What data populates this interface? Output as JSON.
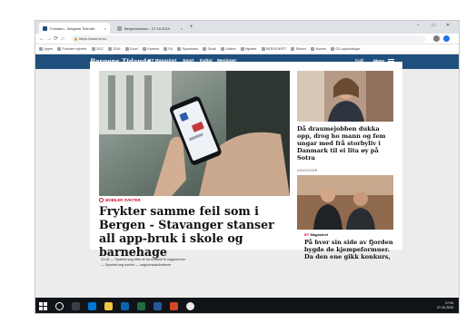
{
  "browser": {
    "tabs": [
      {
        "title": "Forsiden - Bergens Tidende",
        "active": true
      },
      {
        "title": "Bergensavisen - 27.10.2019",
        "active": false
      }
    ],
    "new_tab": "+",
    "window_controls": [
      "–",
      "▭",
      "✕"
    ],
    "nav": {
      "back": "←",
      "forward": "→",
      "reload": "⟳",
      "home": "⌂"
    },
    "url": "https://www.bt.no",
    "bookmarks": [
      "Apper",
      "Forsiden nyheter",
      "2017",
      "2016",
      "Excel",
      "Kamera",
      "EA",
      "Sparebank",
      "Gmail",
      "Vosbot",
      "Nyheter",
      "BERGENSET",
      "Skriver",
      "Norske",
      "OD-oppkoblinger"
    ]
  },
  "site": {
    "logo": "Bergens Tidende",
    "nav_items": [
      "BT Magasinet",
      "Sport",
      "Kultur",
      "Meninger"
    ],
    "login": "Kjøll",
    "menu_label": "Meny"
  },
  "article": {
    "kicker": "MOBILER SVIKTER",
    "headline": "Frykter samme feil som i Bergen - Stavanger stanser all app-bruk i skole og barnehage",
    "sublink": "31:16 — Sparket seg etter at ha snakket til ungdommer",
    "sublink2": "— Sparket seg sortert — ungdomsskoleelever"
  },
  "side_articles": [
    {
      "title": "Då draumejobben dukka opp, drog ho mann og fem ungar med frå storbyliv i Danmark til ei lita øy på Sotra",
      "label": ""
    },
    {
      "label": "ANNONSØR",
      "badge_prefix": "BT",
      "badge_rest": "Magasinet",
      "title": "På hver sin side av fjorden bygde de kjempeformuer. Da den ene gikk konkurs,"
    }
  ],
  "taskbar": {
    "time": "17:04",
    "date": "27.10.2019"
  },
  "colors": {
    "brand_blue": "#1f4f7d",
    "accent_red": "#c8102e",
    "taskbar": "#101318"
  }
}
